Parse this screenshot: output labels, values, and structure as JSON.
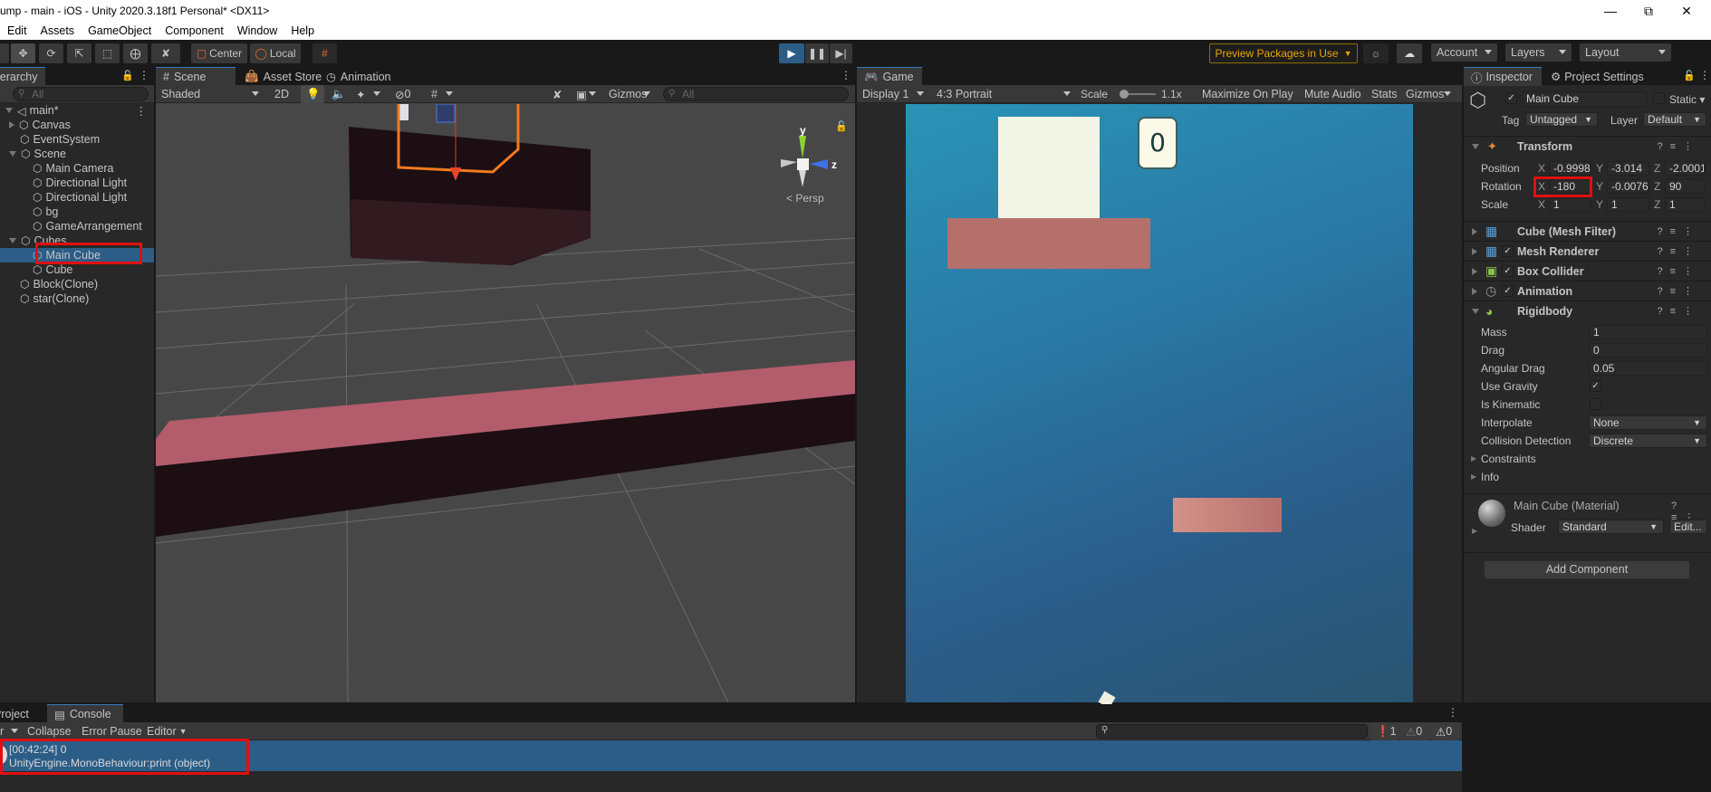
{
  "window": {
    "title": "ump - main - iOS - Unity 2020.3.18f1 Personal* <DX11>",
    "controls": [
      "minimize",
      "restore",
      "close"
    ]
  },
  "menu": [
    "Edit",
    "Assets",
    "GameObject",
    "Component",
    "Window",
    "Help"
  ],
  "toolbar": {
    "pivot_label": "Center",
    "space_label": "Local",
    "preview_packages": "Preview Packages in Use",
    "account": "Account",
    "layers": "Layers",
    "layout": "Layout",
    "accent_color": "#2c5d87",
    "warning_color": "#e8a700"
  },
  "hierarchy": {
    "tab": "Hierarchy",
    "search_placeholder": "All",
    "scene": "main*",
    "items": [
      {
        "label": "Canvas",
        "depth": 1,
        "expand": "collapsed"
      },
      {
        "label": "EventSystem",
        "depth": 1,
        "expand": "none"
      },
      {
        "label": "Scene",
        "depth": 1,
        "expand": "expanded"
      },
      {
        "label": "Main Camera",
        "depth": 2,
        "expand": "none"
      },
      {
        "label": "Directional Light",
        "depth": 2,
        "expand": "none"
      },
      {
        "label": "Directional Light",
        "depth": 2,
        "expand": "none"
      },
      {
        "label": "bg",
        "depth": 2,
        "expand": "none"
      },
      {
        "label": "GameArrangement",
        "depth": 2,
        "expand": "none"
      },
      {
        "label": "Cubes",
        "depth": 1,
        "expand": "expanded"
      },
      {
        "label": "Main Cube",
        "depth": 2,
        "expand": "none",
        "selected": true
      },
      {
        "label": "Cube",
        "depth": 2,
        "expand": "none"
      },
      {
        "label": "Block(Clone)",
        "depth": 1,
        "expand": "none"
      },
      {
        "label": "star(Clone)",
        "depth": 1,
        "expand": "none"
      }
    ]
  },
  "scene_view": {
    "tabs": [
      "Scene",
      "Asset Store",
      "Animation"
    ],
    "shading": "Shaded",
    "mode_2d": "2D",
    "hidden_count": "0",
    "gizmos": "Gizmos",
    "search_placeholder": "All",
    "projection": "Persp",
    "axis_y": "y",
    "axis_z": "z"
  },
  "game_view": {
    "tab": "Game",
    "display": "Display 1",
    "aspect": "4:3 Portrait",
    "scale_label": "Scale",
    "scale_value": "1.1x",
    "maximize": "Maximize On Play",
    "mute": "Mute Audio",
    "stats": "Stats",
    "gizmos": "Gizmos",
    "score": "0"
  },
  "inspector": {
    "tabs": [
      "Inspector",
      "Project Settings"
    ],
    "object_name": "Main Cube",
    "active": true,
    "static_label": "Static",
    "tag_label": "Tag",
    "tag": "Untagged",
    "layer_label": "Layer",
    "layer": "Default",
    "transform": {
      "title": "Transform",
      "position": {
        "label": "Position",
        "x": "-0.9998",
        "y": "-3.014",
        "z": "-2.0001"
      },
      "rotation": {
        "label": "Rotation",
        "x": "-180",
        "y": "-0.0076",
        "z": "90"
      },
      "scale": {
        "label": "Scale",
        "x": "1",
        "y": "1",
        "z": "1"
      }
    },
    "components": [
      {
        "name": "Cube (Mesh Filter)",
        "checkbox": false
      },
      {
        "name": "Mesh Renderer",
        "checkbox": true
      },
      {
        "name": "Box Collider",
        "checkbox": true
      },
      {
        "name": "Animation",
        "checkbox": true
      },
      {
        "name": "Rigidbody",
        "checkbox": false
      }
    ],
    "rigidbody": {
      "mass_label": "Mass",
      "mass": "1",
      "drag_label": "Drag",
      "drag": "0",
      "angular_drag_label": "Angular Drag",
      "angular_drag": "0.05",
      "use_gravity_label": "Use Gravity",
      "use_gravity": true,
      "is_kinematic_label": "Is Kinematic",
      "is_kinematic": false,
      "interpolate_label": "Interpolate",
      "interpolate": "None",
      "collision_label": "Collision Detection",
      "collision": "Discrete",
      "constraints_label": "Constraints",
      "info_label": "Info"
    },
    "material": {
      "name": "Main Cube (Material)",
      "shader_label": "Shader",
      "shader": "Standard",
      "edit": "Edit..."
    },
    "add_component": "Add Component"
  },
  "console": {
    "tabs": [
      "Project",
      "Console"
    ],
    "clear_label": "r",
    "collapse": "Collapse",
    "error_pause": "Error Pause",
    "editor": "Editor",
    "counts": {
      "info": "1",
      "warning": "0",
      "error": "0"
    },
    "entries": [
      {
        "line1": "[00:42:24] 0",
        "line2": "UnityEngine.MonoBehaviour:print (object)"
      }
    ]
  }
}
